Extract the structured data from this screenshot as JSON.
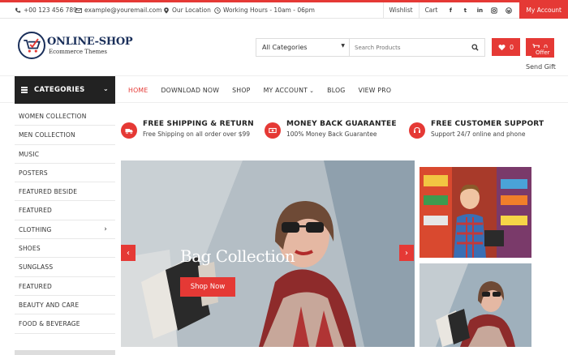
{
  "topbar": {
    "phone": "+00 123 456 789",
    "email": "example@youremail.com",
    "location": "Our Location",
    "hours": "Working Hours - 10am - 06pm",
    "wishlist": "Wishlist",
    "cart": "Cart",
    "social": [
      "f",
      "t",
      "in",
      "ig",
      "wp"
    ],
    "account": "My Account"
  },
  "logo": {
    "name": "ONLINE-SHOP",
    "tagline": "Ecommerce Themes"
  },
  "search": {
    "category": "All Categories",
    "placeholder": "Search Products"
  },
  "wishlist_count": "0",
  "cart_count": "0",
  "offer": "Offer",
  "send_gift": "Send Gift",
  "categories_title": "CATEGORIES",
  "nav": [
    "HOME",
    "DOWNLOAD NOW",
    "SHOP",
    "MY ACCOUNT",
    "BLOG",
    "VIEW PRO"
  ],
  "sidebar": [
    "WOMEN COLLECTION",
    "MEN COLLECTION",
    "MUSIC",
    "POSTERS",
    "FEATURED BESIDE",
    "FEATURED",
    "CLOTHING",
    "SHOES",
    "SUNGLASS",
    "FEATURED",
    "BEAUTY AND CARE",
    "FOOD & BEVERAGE"
  ],
  "features": [
    {
      "title": "FREE SHIPPING & RETURN",
      "sub": "Free Shipping on all order over $99",
      "icon": "truck-icon"
    },
    {
      "title": "MONEY BACK GUARANTEE",
      "sub": "100% Money Back Guarantee",
      "icon": "money-icon"
    },
    {
      "title": "FREE CUSTOMER SUPPORT",
      "sub": "Support 24/7 online and phone",
      "icon": "headset-icon"
    }
  ],
  "hero": {
    "title": "Bag Collection",
    "button": "Shop Now"
  },
  "colors": {
    "accent": "#e53935",
    "dark": "#222222",
    "brand": "#1a2f5a"
  }
}
